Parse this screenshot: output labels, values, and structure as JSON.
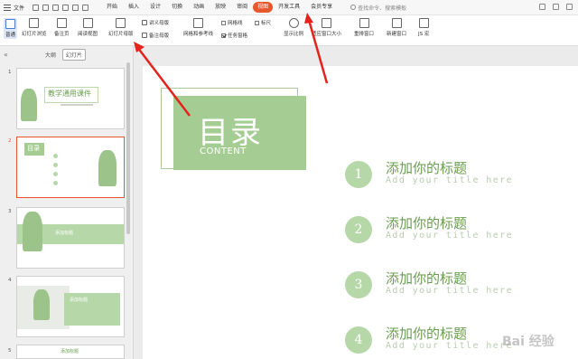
{
  "menubar": {
    "file_label": "文件",
    "tabs": [
      "开始",
      "插入",
      "设计",
      "切换",
      "动画",
      "放映",
      "审阅",
      "视图",
      "开发工具",
      "会员专享"
    ],
    "active_tab": "视图",
    "search_placeholder": "查找命令、搜索模板"
  },
  "ribbon": {
    "buttons": {
      "normal": "普通",
      "slide_sorter": "幻灯片浏览",
      "notes_page": "备注页",
      "reading_view": "阅读视图",
      "slide_master": "幻灯片母版",
      "handout_master": "讲义母版",
      "notes_master": "备注母版",
      "grid_guides": "网格和参考线",
      "gridlines": "网格线",
      "ruler": "标尺",
      "task_pane": "任务窗格",
      "zoom": "显示比例",
      "fit_window": "适应窗口大小",
      "arrange_window": "重排窗口",
      "new_window": "新建窗口",
      "more": "JS 宏"
    }
  },
  "leftpanel": {
    "tab_outline": "大纲",
    "tab_slides": "幻灯片",
    "thumbs": [
      {
        "num": "1",
        "title": "教学通用课件"
      },
      {
        "num": "2",
        "title": "目录"
      },
      {
        "num": "3",
        "title": "添加标题"
      },
      {
        "num": "4",
        "title": "添加标题"
      },
      {
        "num": "5",
        "title": "添加标题"
      }
    ]
  },
  "slide": {
    "title": "目录",
    "subtitle": "CONTENT",
    "items": [
      {
        "num": "1",
        "title": "添加你的标题",
        "sub": "Add your title here"
      },
      {
        "num": "2",
        "title": "添加你的标题",
        "sub": "Add your title here"
      },
      {
        "num": "3",
        "title": "添加你的标题",
        "sub": "Add your title here"
      },
      {
        "num": "4",
        "title": "添加你的标题",
        "sub": "Add your title here"
      }
    ]
  },
  "watermark": "Bai 经验",
  "colors": {
    "accent": "#e8562e",
    "green": "#a5cd93",
    "green_text": "#6a9d52"
  }
}
